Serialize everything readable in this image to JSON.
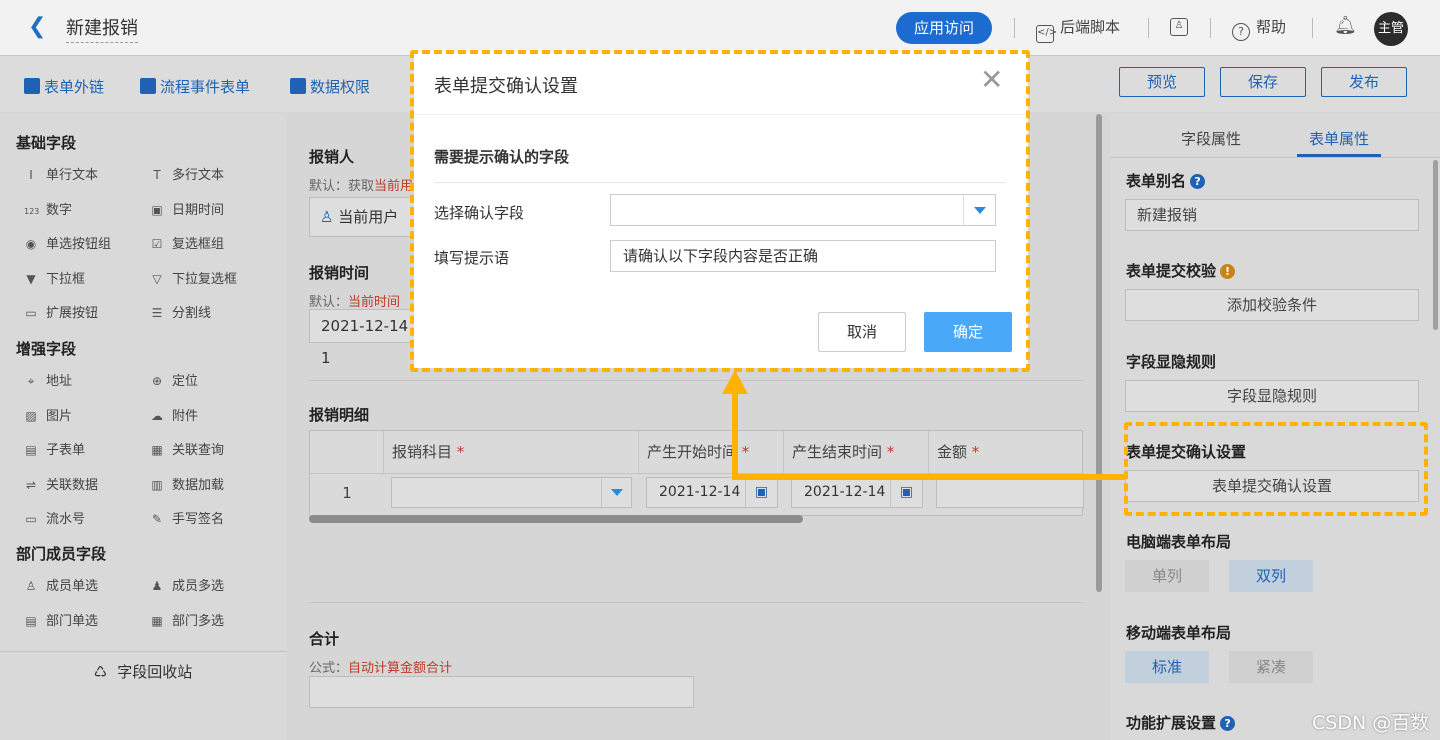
{
  "header": {
    "back_icon": "chevron-left-icon",
    "title": "新建报销",
    "visit_label": "应用访问",
    "backend_script": "后端脚本",
    "help": "帮助",
    "avatar_text": "主管"
  },
  "toolbar": {
    "external_link": "表单外链",
    "flow_event_form": "流程事件表单",
    "data_permission": "数据权限",
    "preview": "预览",
    "save": "保存",
    "publish": "发布"
  },
  "palette": {
    "basic_title": "基础字段",
    "basic": [
      {
        "icon": "text-icon",
        "glyph": "I",
        "label": "单行文本"
      },
      {
        "icon": "multiline-icon",
        "glyph": "T",
        "label": "多行文本"
      },
      {
        "icon": "number-icon",
        "glyph": "123",
        "label": "数字"
      },
      {
        "icon": "calendar-icon",
        "glyph": "▣",
        "label": "日期时间"
      },
      {
        "icon": "radio-icon",
        "glyph": "◉",
        "label": "单选按钮组"
      },
      {
        "icon": "checkbox-icon",
        "glyph": "☑",
        "label": "复选框组"
      },
      {
        "icon": "dropdown-icon",
        "glyph": "▼",
        "label": "下拉框"
      },
      {
        "icon": "multi-dropdown-icon",
        "glyph": "▽",
        "label": "下拉复选框"
      },
      {
        "icon": "extend-button-icon",
        "glyph": "▭",
        "label": "扩展按钮"
      },
      {
        "icon": "divider-icon",
        "glyph": "☰",
        "label": "分割线"
      }
    ],
    "enhanced_title": "增强字段",
    "enhanced": [
      {
        "icon": "location-pin-icon",
        "glyph": "⌖",
        "label": "地址"
      },
      {
        "icon": "locate-icon",
        "glyph": "⊕",
        "label": "定位"
      },
      {
        "icon": "image-icon",
        "glyph": "▨",
        "label": "图片"
      },
      {
        "icon": "cloud-upload-icon",
        "glyph": "☁",
        "label": "附件"
      },
      {
        "icon": "subform-icon",
        "glyph": "▤",
        "label": "子表单"
      },
      {
        "icon": "relation-query-icon",
        "glyph": "▦",
        "label": "关联查询"
      },
      {
        "icon": "link-data-icon",
        "glyph": "⇌",
        "label": "关联数据"
      },
      {
        "icon": "bar-chart-icon",
        "glyph": "▥",
        "label": "数据加载"
      },
      {
        "icon": "serial-number-icon",
        "glyph": "▭",
        "label": "流水号"
      },
      {
        "icon": "pen-icon",
        "glyph": "✎",
        "label": "手写签名"
      }
    ],
    "dept_title": "部门成员字段",
    "dept": [
      {
        "icon": "user-icon",
        "glyph": "♙",
        "label": "成员单选"
      },
      {
        "icon": "users-icon",
        "glyph": "♟",
        "label": "成员多选"
      },
      {
        "icon": "department-icon",
        "glyph": "▤",
        "label": "部门单选"
      },
      {
        "icon": "departments-icon",
        "glyph": "▦",
        "label": "部门多选"
      }
    ],
    "recycle_icon": "recycle-icon",
    "recycle_label": "字段回收站"
  },
  "form": {
    "applicant_label": "报销人",
    "applicant_hint_prefix": "默认：获取",
    "applicant_hint_value": "当前用",
    "applicant_value": "当前用户",
    "time_label": "报销时间",
    "time_hint_prefix": "默认：",
    "time_hint_value": "当前时间",
    "time_value": "2021-12-14 1",
    "detail_label": "报销明细",
    "columns": [
      {
        "label": "报销科目",
        "required": "*"
      },
      {
        "label": "产生开始时间",
        "required": "*"
      },
      {
        "label": "产生结束时间",
        "required": "*"
      },
      {
        "label": "金额",
        "required": "*"
      }
    ],
    "row_index": "1",
    "start_date": "2021-12-14",
    "end_date": "2021-12-14",
    "total_label": "合计",
    "total_hint_prefix": "公式：",
    "total_hint_value": "自动计算金额合计"
  },
  "right_panel": {
    "tab_field": "字段属性",
    "tab_form": "表单属性",
    "alias_label": "表单别名",
    "alias_value": "新建报销",
    "submit_check_label": "表单提交校验",
    "add_check_button": "添加校验条件",
    "visibility_label": "字段显隐规则",
    "visibility_button": "字段显隐规则",
    "confirm_label": "表单提交确认设置",
    "confirm_button": "表单提交确认设置",
    "pc_layout_label": "电脑端表单布局",
    "pc_single": "单列",
    "pc_double": "双列",
    "mobile_layout_label": "移动端表单布局",
    "mobile_standard": "标准",
    "mobile_compact": "紧凑",
    "extension_label": "功能扩展设置"
  },
  "dialog": {
    "title": "表单提交确认设置",
    "close_icon": "close-icon",
    "section": "需要提示确认的字段",
    "select_label": "选择确认字段",
    "select_value": "",
    "prompt_label": "填写提示语",
    "prompt_value": "请确认以下字段内容是否正确",
    "cancel": "取消",
    "confirm": "确定"
  },
  "colors": {
    "highlight": "#ffb300",
    "primary": "#1f62b5",
    "confirm_button": "#49a9f8"
  },
  "watermark": "CSDN @百数"
}
